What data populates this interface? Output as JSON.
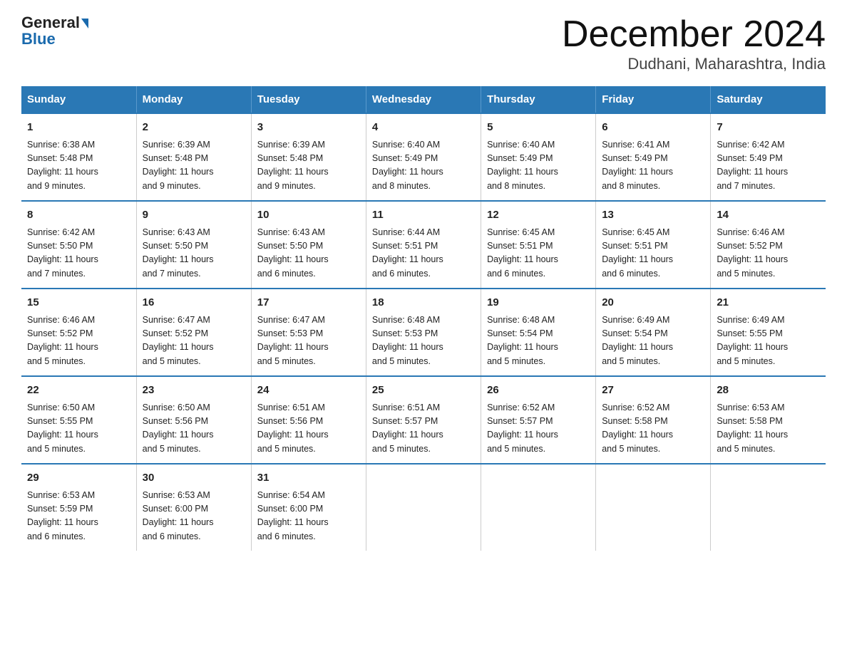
{
  "header": {
    "logo_general": "General",
    "logo_blue": "Blue",
    "month_title": "December 2024",
    "location": "Dudhani, Maharashtra, India"
  },
  "days_of_week": [
    "Sunday",
    "Monday",
    "Tuesday",
    "Wednesday",
    "Thursday",
    "Friday",
    "Saturday"
  ],
  "weeks": [
    [
      {
        "day": "1",
        "info": "Sunrise: 6:38 AM\nSunset: 5:48 PM\nDaylight: 11 hours\nand 9 minutes."
      },
      {
        "day": "2",
        "info": "Sunrise: 6:39 AM\nSunset: 5:48 PM\nDaylight: 11 hours\nand 9 minutes."
      },
      {
        "day": "3",
        "info": "Sunrise: 6:39 AM\nSunset: 5:48 PM\nDaylight: 11 hours\nand 9 minutes."
      },
      {
        "day": "4",
        "info": "Sunrise: 6:40 AM\nSunset: 5:49 PM\nDaylight: 11 hours\nand 8 minutes."
      },
      {
        "day": "5",
        "info": "Sunrise: 6:40 AM\nSunset: 5:49 PM\nDaylight: 11 hours\nand 8 minutes."
      },
      {
        "day": "6",
        "info": "Sunrise: 6:41 AM\nSunset: 5:49 PM\nDaylight: 11 hours\nand 8 minutes."
      },
      {
        "day": "7",
        "info": "Sunrise: 6:42 AM\nSunset: 5:49 PM\nDaylight: 11 hours\nand 7 minutes."
      }
    ],
    [
      {
        "day": "8",
        "info": "Sunrise: 6:42 AM\nSunset: 5:50 PM\nDaylight: 11 hours\nand 7 minutes."
      },
      {
        "day": "9",
        "info": "Sunrise: 6:43 AM\nSunset: 5:50 PM\nDaylight: 11 hours\nand 7 minutes."
      },
      {
        "day": "10",
        "info": "Sunrise: 6:43 AM\nSunset: 5:50 PM\nDaylight: 11 hours\nand 6 minutes."
      },
      {
        "day": "11",
        "info": "Sunrise: 6:44 AM\nSunset: 5:51 PM\nDaylight: 11 hours\nand 6 minutes."
      },
      {
        "day": "12",
        "info": "Sunrise: 6:45 AM\nSunset: 5:51 PM\nDaylight: 11 hours\nand 6 minutes."
      },
      {
        "day": "13",
        "info": "Sunrise: 6:45 AM\nSunset: 5:51 PM\nDaylight: 11 hours\nand 6 minutes."
      },
      {
        "day": "14",
        "info": "Sunrise: 6:46 AM\nSunset: 5:52 PM\nDaylight: 11 hours\nand 5 minutes."
      }
    ],
    [
      {
        "day": "15",
        "info": "Sunrise: 6:46 AM\nSunset: 5:52 PM\nDaylight: 11 hours\nand 5 minutes."
      },
      {
        "day": "16",
        "info": "Sunrise: 6:47 AM\nSunset: 5:52 PM\nDaylight: 11 hours\nand 5 minutes."
      },
      {
        "day": "17",
        "info": "Sunrise: 6:47 AM\nSunset: 5:53 PM\nDaylight: 11 hours\nand 5 minutes."
      },
      {
        "day": "18",
        "info": "Sunrise: 6:48 AM\nSunset: 5:53 PM\nDaylight: 11 hours\nand 5 minutes."
      },
      {
        "day": "19",
        "info": "Sunrise: 6:48 AM\nSunset: 5:54 PM\nDaylight: 11 hours\nand 5 minutes."
      },
      {
        "day": "20",
        "info": "Sunrise: 6:49 AM\nSunset: 5:54 PM\nDaylight: 11 hours\nand 5 minutes."
      },
      {
        "day": "21",
        "info": "Sunrise: 6:49 AM\nSunset: 5:55 PM\nDaylight: 11 hours\nand 5 minutes."
      }
    ],
    [
      {
        "day": "22",
        "info": "Sunrise: 6:50 AM\nSunset: 5:55 PM\nDaylight: 11 hours\nand 5 minutes."
      },
      {
        "day": "23",
        "info": "Sunrise: 6:50 AM\nSunset: 5:56 PM\nDaylight: 11 hours\nand 5 minutes."
      },
      {
        "day": "24",
        "info": "Sunrise: 6:51 AM\nSunset: 5:56 PM\nDaylight: 11 hours\nand 5 minutes."
      },
      {
        "day": "25",
        "info": "Sunrise: 6:51 AM\nSunset: 5:57 PM\nDaylight: 11 hours\nand 5 minutes."
      },
      {
        "day": "26",
        "info": "Sunrise: 6:52 AM\nSunset: 5:57 PM\nDaylight: 11 hours\nand 5 minutes."
      },
      {
        "day": "27",
        "info": "Sunrise: 6:52 AM\nSunset: 5:58 PM\nDaylight: 11 hours\nand 5 minutes."
      },
      {
        "day": "28",
        "info": "Sunrise: 6:53 AM\nSunset: 5:58 PM\nDaylight: 11 hours\nand 5 minutes."
      }
    ],
    [
      {
        "day": "29",
        "info": "Sunrise: 6:53 AM\nSunset: 5:59 PM\nDaylight: 11 hours\nand 6 minutes."
      },
      {
        "day": "30",
        "info": "Sunrise: 6:53 AM\nSunset: 6:00 PM\nDaylight: 11 hours\nand 6 minutes."
      },
      {
        "day": "31",
        "info": "Sunrise: 6:54 AM\nSunset: 6:00 PM\nDaylight: 11 hours\nand 6 minutes."
      },
      {
        "day": "",
        "info": ""
      },
      {
        "day": "",
        "info": ""
      },
      {
        "day": "",
        "info": ""
      },
      {
        "day": "",
        "info": ""
      }
    ]
  ]
}
